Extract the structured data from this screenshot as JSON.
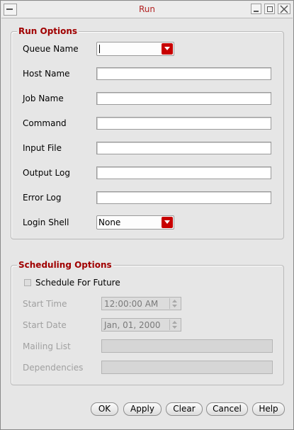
{
  "window": {
    "title": "Run"
  },
  "run_options": {
    "title": "Run Options",
    "queue_name": {
      "label": "Queue Name",
      "value": ""
    },
    "host_name": {
      "label": "Host Name",
      "value": ""
    },
    "job_name": {
      "label": "Job Name",
      "value": ""
    },
    "command": {
      "label": "Command",
      "value": ""
    },
    "input_file": {
      "label": "Input File",
      "value": ""
    },
    "output_log": {
      "label": "Output Log",
      "value": ""
    },
    "error_log": {
      "label": "Error Log",
      "value": ""
    },
    "login_shell": {
      "label": "Login Shell",
      "value": "None"
    }
  },
  "scheduling_options": {
    "title": "Scheduling Options",
    "schedule_for_future": {
      "label": "Schedule For Future",
      "checked": false
    },
    "start_time": {
      "label": "Start Time",
      "value": "12:00:00 AM"
    },
    "start_date": {
      "label": "Start Date",
      "value": "Jan, 01, 2000"
    },
    "mailing_list": {
      "label": "Mailing List",
      "value": ""
    },
    "dependencies": {
      "label": "Dependencies",
      "value": ""
    }
  },
  "buttons": {
    "ok": "OK",
    "apply": "Apply",
    "clear": "Clear",
    "cancel": "Cancel",
    "help": "Help"
  },
  "colors": {
    "accent_red": "#c80000",
    "group_title": "#a00000",
    "window_title": "#b22222"
  }
}
